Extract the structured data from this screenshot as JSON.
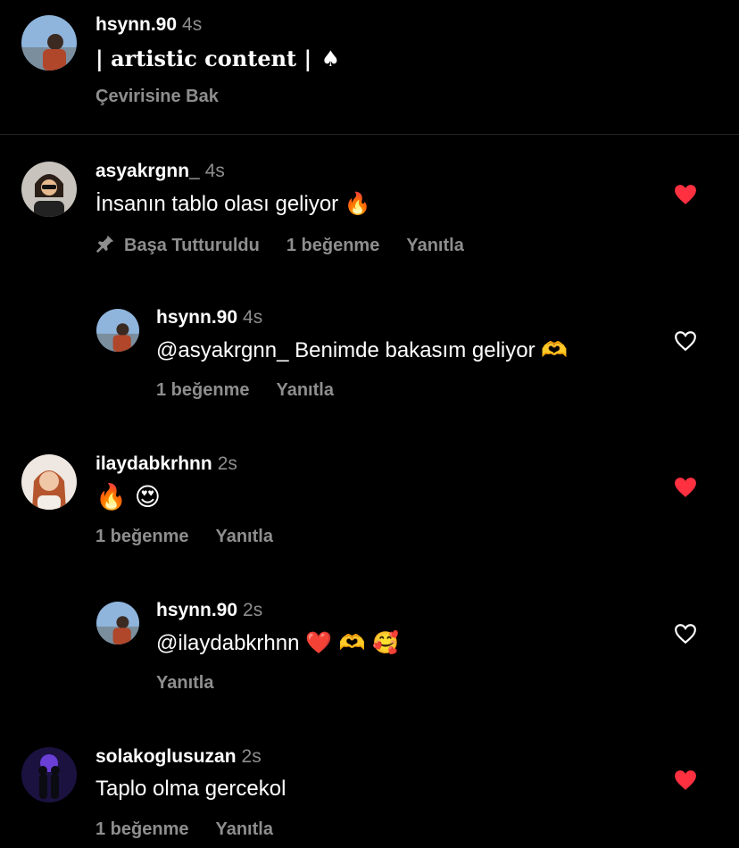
{
  "caption": {
    "username": "hsynn.90",
    "time": "4s",
    "text": "| artistic content |",
    "emoji": "♠",
    "translate": "Çevirisine Bak"
  },
  "comments": [
    {
      "username": "asyakrgnn_",
      "time": "4s",
      "text": "İnsanın tablo olası geliyor",
      "emoji": "🔥",
      "pinned": "Başa Tutturuldu",
      "likes": "1 beğenme",
      "reply": "Yanıtla",
      "liked": true
    },
    {
      "username": "hsynn.90",
      "time": "4s",
      "text": "@asyakrgnn_  Benimde bakasım geliyor",
      "emoji": "🫶",
      "likes": "1 beğenme",
      "reply": "Yanıtla",
      "liked": false
    },
    {
      "username": "ilaydabkrhnn",
      "time": "2s",
      "text": "",
      "emoji": "🔥 😍",
      "likes": "1 beğenme",
      "reply": "Yanıtla",
      "liked": true
    },
    {
      "username": "hsynn.90",
      "time": "2s",
      "text": "@ilaydabkrhnn",
      "emoji": "❤️ 🫶 🥰",
      "reply": "Yanıtla",
      "liked": false
    },
    {
      "username": "solakoglusuzan",
      "time": "2s",
      "text": "Taplo olma gercekol",
      "likes": "1 beğenme",
      "reply": "Yanıtla",
      "liked": true
    }
  ],
  "colors": {
    "background": "#000000",
    "muted": "#8e8e8e",
    "like_red": "#ff3040"
  },
  "icons": [
    "heart-filled-icon",
    "heart-outline-icon",
    "pin-icon",
    "spade-icon"
  ]
}
